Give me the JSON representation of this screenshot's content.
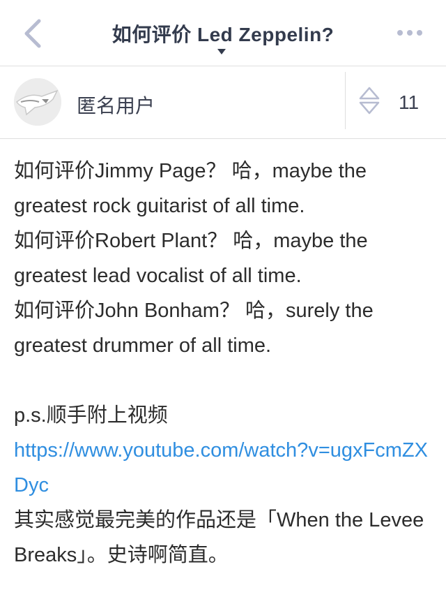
{
  "nav": {
    "title": "如何评价 Led Zeppelin?"
  },
  "author": {
    "name": "匿名用户",
    "vote_count": "11"
  },
  "content": {
    "lines": [
      "如何评价Jimmy Page？ 哈，maybe the greatest rock guitarist of all time.",
      "如何评价Robert Plant？ 哈，maybe the greatest lead vocalist of all time.",
      "如何评价John Bonham？ 哈，surely the greatest drummer of all time."
    ],
    "ps": "p.s.顺手附上视频",
    "link": "https://www.youtube.com/watch?v=ugxFcmZXDyc",
    "closing": "其实感觉最完美的作品还是「When the Levee Breaks」。史诗啊简直。"
  },
  "colors": {
    "link": "#2f8ee0",
    "icon_accent": "#b7bcd1",
    "title_text": "#333b4d"
  },
  "icons": {
    "back": "chevron-left-icon",
    "more": "more-dots-icon",
    "vote": "vote-arrows-icon",
    "title_dropdown": "caret-down-icon"
  }
}
